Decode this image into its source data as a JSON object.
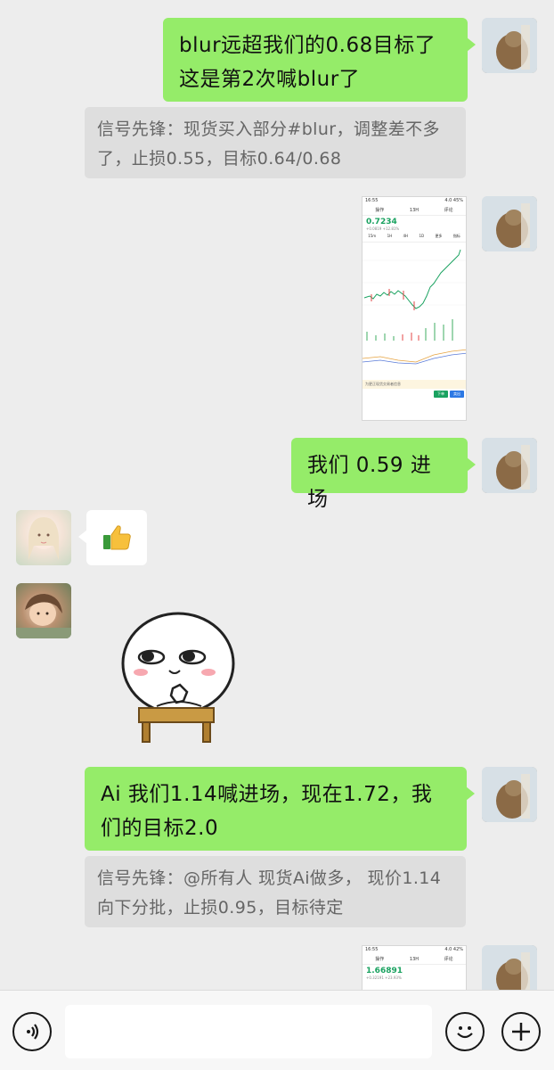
{
  "messages": {
    "m1_line1": "blur远超我们的0.68目标了",
    "m1_line2": "这是第2次喊blur了",
    "q1_line1": "信号先锋：现货买入部分#blur，调整差不多",
    "q1_line2": "了，止损0.55，目标0.64/0.68",
    "m2": "我们 0.59 进场",
    "m3_line1": "Ai 我们1.14喊进场，现在1.72，我",
    "m3_line2": "们的目标2.0",
    "q2_line1": "信号先锋：@所有人 现货Ai做多， 现价1.14",
    "q2_line2": "向下分批，止损0.95，目标待定"
  },
  "screenshot1": {
    "status_time": "16:55",
    "status_right": "4.0 45%",
    "nav": [
      "操作",
      "13H",
      "评论"
    ],
    "price": "0.7234",
    "change": "+0.0819 +12.81%",
    "tabs": [
      "15m",
      "1H",
      "4H",
      "1D",
      "更多",
      "指标"
    ],
    "banner": "为更正现货交易者信息",
    "buttons": [
      "下单",
      "卖出"
    ]
  },
  "screenshot2": {
    "status_time": "16:55",
    "status_right": "4.0 42%",
    "nav": [
      "操作",
      "13H",
      "评论"
    ],
    "price": "1.66891",
    "change": "+0.32191 +23.93%"
  },
  "reactions": {
    "thumbs_up": "👍"
  },
  "input": {
    "placeholder": ""
  },
  "colors": {
    "bubble_green": "#95ec69",
    "bubble_white": "#ffffff",
    "quote_bg": "#dedede",
    "background": "#ededed",
    "price_green": "#1aa260"
  }
}
